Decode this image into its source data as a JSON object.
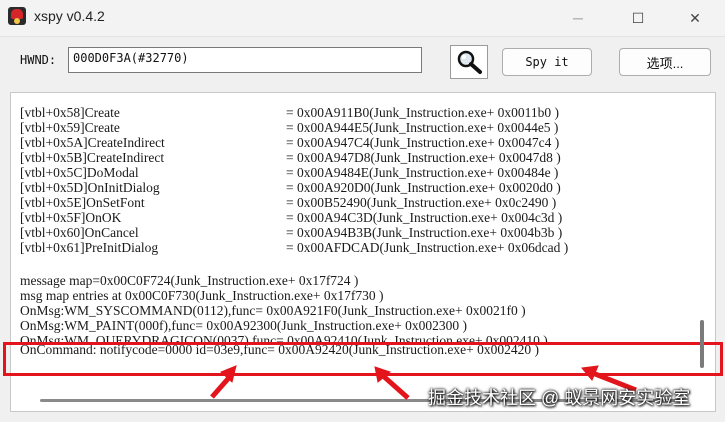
{
  "window": {
    "title": "xspy v0.4.2",
    "controls": {
      "minimize": "─",
      "maximize": "☐",
      "close": "✕"
    }
  },
  "toolbar": {
    "hwnd_label": "HWND:",
    "hwnd_value": "000D0F3A(#32770)",
    "finder_icon": "magnifier-icon",
    "spy_label": "Spy it",
    "options_label": "选项..."
  },
  "vtable": [
    {
      "label": "[vtbl+0x58]Create",
      "value": "= 0x00A911B0(Junk_Instruction.exe+ 0x0011b0 )"
    },
    {
      "label": "[vtbl+0x59]Create",
      "value": "= 0x00A944E5(Junk_Instruction.exe+ 0x0044e5 )"
    },
    {
      "label": "[vtbl+0x5A]CreateIndirect",
      "value": "= 0x00A947C4(Junk_Instruction.exe+ 0x0047c4 )"
    },
    {
      "label": "[vtbl+0x5B]CreateIndirect",
      "value": "= 0x00A947D8(Junk_Instruction.exe+ 0x0047d8 )"
    },
    {
      "label": "[vtbl+0x5C]DoModal",
      "value": "= 0x00A9484E(Junk_Instruction.exe+ 0x00484e )"
    },
    {
      "label": "[vtbl+0x5D]OnInitDialog",
      "value": "= 0x00A920D0(Junk_Instruction.exe+ 0x0020d0 )"
    },
    {
      "label": "[vtbl+0x5E]OnSetFont",
      "value": "= 0x00B52490(Junk_Instruction.exe+ 0x0c2490 )"
    },
    {
      "label": "[vtbl+0x5F]OnOK",
      "value": "= 0x00A94C3D(Junk_Instruction.exe+ 0x004c3d )"
    },
    {
      "label": "[vtbl+0x60]OnCancel",
      "value": "= 0x00A94B3B(Junk_Instruction.exe+ 0x004b3b )"
    },
    {
      "label": "[vtbl+0x61]PreInitDialog",
      "value": "= 0x00AFDCAD(Junk_Instruction.exe+ 0x06dcad )"
    }
  ],
  "message_lines": [
    "message map=0x00C0F724(Junk_Instruction.exe+ 0x17f724 )",
    "msg map entries at 0x00C0F730(Junk_Instruction.exe+ 0x17f730 )",
    "OnMsg:WM_SYSCOMMAND(0112),func= 0x00A921F0(Junk_Instruction.exe+ 0x0021f0 )",
    "OnMsg:WM_PAINT(000f),func= 0x00A92300(Junk_Instruction.exe+ 0x002300 )",
    "OnMsg:WM_QUERYDRAGICON(0037),func= 0x00A92410(Junk_Instruction.exe+ 0x002410 )",
    "OnCommand: notifycode=0000 id=03e9,func= 0x00A92420(Junk_Instruction.exe+ 0x002420 )"
  ],
  "colors": {
    "highlight": "#e3141b",
    "arrow": "#e3141b"
  },
  "watermark": "掘金技术社区 @ 蚁景网安实验室"
}
